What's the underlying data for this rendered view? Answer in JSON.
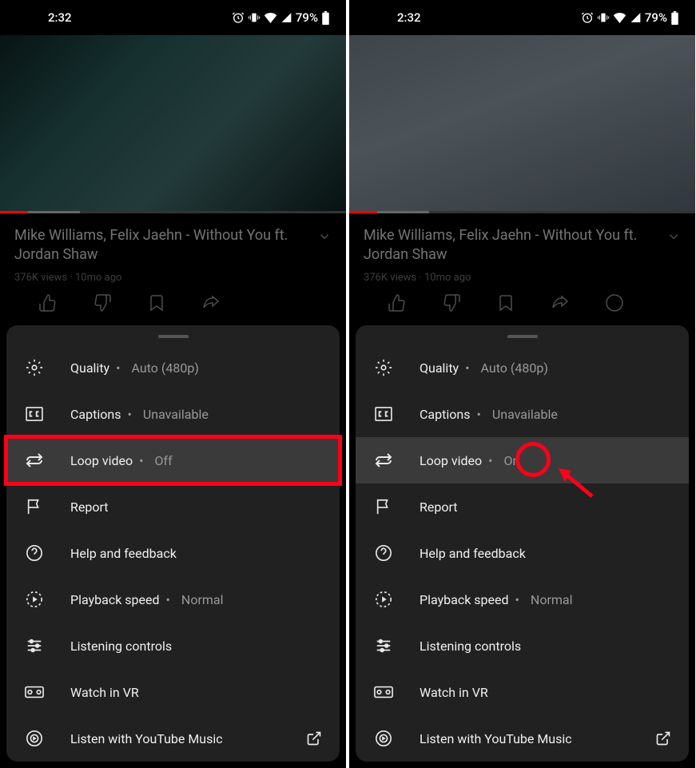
{
  "status": {
    "time": "2:32",
    "battery": "79%"
  },
  "video": {
    "title": "Mike Williams, Felix Jaehn - Without You ft. Jordan Shaw",
    "views": "376K views",
    "age": "10mo ago"
  },
  "menu": {
    "quality": {
      "label": "Quality",
      "value": "Auto (480p)"
    },
    "captions": {
      "label": "Captions",
      "value": "Unavailable"
    },
    "loop": {
      "label": "Loop video",
      "value_off": "Off",
      "value_on": "On"
    },
    "report": {
      "label": "Report"
    },
    "help": {
      "label": "Help and feedback"
    },
    "speed": {
      "label": "Playback speed",
      "value": "Normal"
    },
    "listening": {
      "label": "Listening controls"
    },
    "vr": {
      "label": "Watch in VR"
    },
    "ytmusic": {
      "label": "Listen with YouTube Music"
    }
  }
}
